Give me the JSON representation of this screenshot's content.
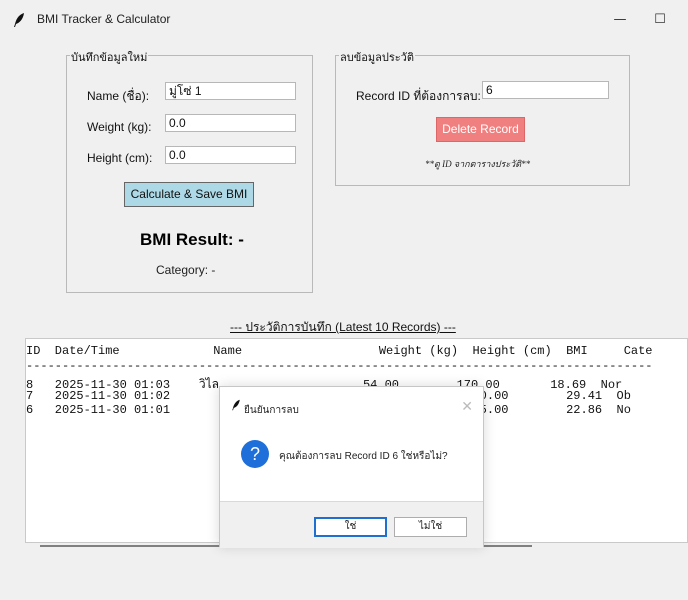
{
  "window": {
    "title": "BMI Tracker & Calculator",
    "controls": {
      "minimize": "—",
      "maximize": "☐",
      "close": "✕"
    }
  },
  "add_form": {
    "legend": "บันทึกข้อมูลใหม่",
    "name_label": "Name (ชื่อ):",
    "name_value": "มู่โซ่ 1",
    "weight_label": "Weight (kg):",
    "weight_value": "0.0",
    "height_label": "Height (cm):",
    "height_value": "0.0",
    "calculate_button": "Calculate & Save BMI",
    "result_text": "BMI Result: -",
    "category_text": "Category: -"
  },
  "delete_form": {
    "legend": "ลบข้อมูลประวัติ",
    "record_label": "Record ID ที่ต้องการลบ:",
    "record_value": "6",
    "delete_button": "Delete Record",
    "hint": "**ดู ID จากตารางประวัติ**"
  },
  "history": {
    "title": "--- ประวัติการบันทึก (Latest 10 Records) ---",
    "header_text": "ID  Date/Time             Name                   Weight (kg)  Height (cm)  BMI     Cate",
    "separator": "---------------------------------------------------------------------------------------",
    "rows": [
      {
        "text": "8   2025-11-30 01:03    วิไล                    54.00        170.00       18.69  Nor"
      },
      {
        "text": "7   2025-11-30 01:02                                         170.00        29.41  Ob"
      },
      {
        "text": "6   2025-11-30 01:01                                         175.00        22.86  No"
      }
    ]
  },
  "dialog": {
    "title": "ยืนยันการลบ",
    "close": "✕",
    "message": "คุณต้องการลบ Record ID 6 ใช่หรือไม่?",
    "yes": "ใช่",
    "no": "ไม่ใช่",
    "icon": "?"
  },
  "icons": {
    "app": "feather-icon",
    "question": "question-icon"
  },
  "colors": {
    "calculate_button": "#add8e6",
    "delete_button": "#f08080",
    "dialog_accent": "#1e6fd9"
  }
}
